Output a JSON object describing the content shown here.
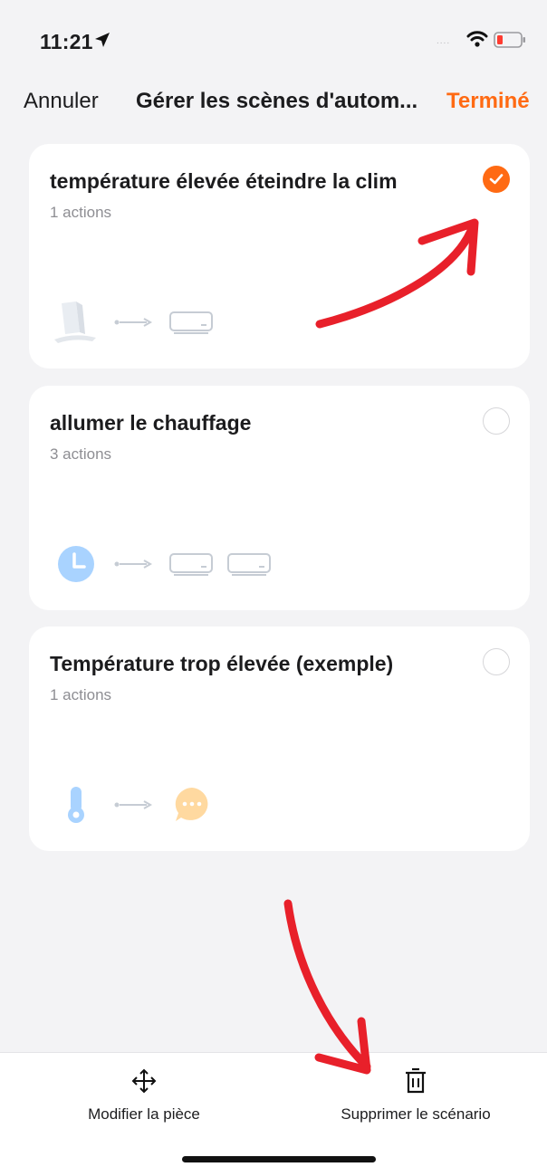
{
  "status_bar": {
    "time": "11:21",
    "signal_dots": "....",
    "icons": [
      "location-arrow-icon",
      "wifi-icon",
      "battery-low-icon"
    ],
    "battery_color": "#ff3b30"
  },
  "nav": {
    "cancel_label": "Annuler",
    "title": "Gérer les scènes d'autom...",
    "done_label": "Terminé",
    "accent_color": "#ff6a13"
  },
  "scenes": [
    {
      "title": "température élevée éteindre la clim",
      "subtitle": "1 actions",
      "selected": true,
      "flow_icons": [
        "sensor-device-icon",
        "arrow-icon",
        "air-conditioner-icon"
      ]
    },
    {
      "title": "allumer le chauffage",
      "subtitle": "3 actions",
      "selected": false,
      "flow_icons": [
        "clock-icon",
        "arrow-icon",
        "air-conditioner-icon",
        "air-conditioner-icon"
      ]
    },
    {
      "title": "Température trop élevée (exemple)",
      "subtitle": "1 actions",
      "selected": false,
      "flow_icons": [
        "thermometer-icon",
        "arrow-icon",
        "message-bubble-icon"
      ]
    }
  ],
  "toolbar": {
    "move_label": "Modifier la pièce",
    "delete_label": "Supprimer le scénario",
    "icons": [
      "move-arrows-icon",
      "trash-icon"
    ]
  },
  "annotation_color": "#e8202a"
}
